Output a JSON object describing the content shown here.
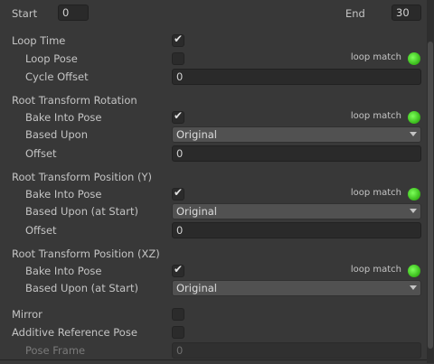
{
  "range": {
    "start_label": "Start",
    "start_value": "0",
    "end_label": "End",
    "end_value": "30"
  },
  "loop_time": {
    "label": "Loop Time",
    "checked": true
  },
  "loop_pose": {
    "label": "Loop Pose",
    "checked": false,
    "match_text": "loop match",
    "match_color": "#48d428"
  },
  "cycle_offset": {
    "label": "Cycle Offset",
    "value": "0"
  },
  "rot": {
    "header": "Root Transform Rotation",
    "bake_label": "Bake Into Pose",
    "bake_checked": true,
    "match_text": "loop match",
    "based_label": "Based Upon",
    "based_value": "Original",
    "offset_label": "Offset",
    "offset_value": "0"
  },
  "pos_y": {
    "header": "Root Transform Position (Y)",
    "bake_label": "Bake Into Pose",
    "bake_checked": true,
    "match_text": "loop match",
    "based_label": "Based Upon (at Start)",
    "based_value": "Original",
    "offset_label": "Offset",
    "offset_value": "0"
  },
  "pos_xz": {
    "header": "Root Transform Position (XZ)",
    "bake_label": "Bake Into Pose",
    "bake_checked": true,
    "match_text": "loop match",
    "based_label": "Based Upon (at Start)",
    "based_value": "Original"
  },
  "mirror": {
    "label": "Mirror",
    "checked": false
  },
  "additive": {
    "label": "Additive Reference Pose",
    "checked": false
  },
  "pose_frame": {
    "label": "Pose Frame",
    "value": "0"
  },
  "colors": {
    "background": "#383838",
    "field": "#2a2a2a",
    "dropdown": "#515151",
    "match_dot": "#48d428"
  }
}
